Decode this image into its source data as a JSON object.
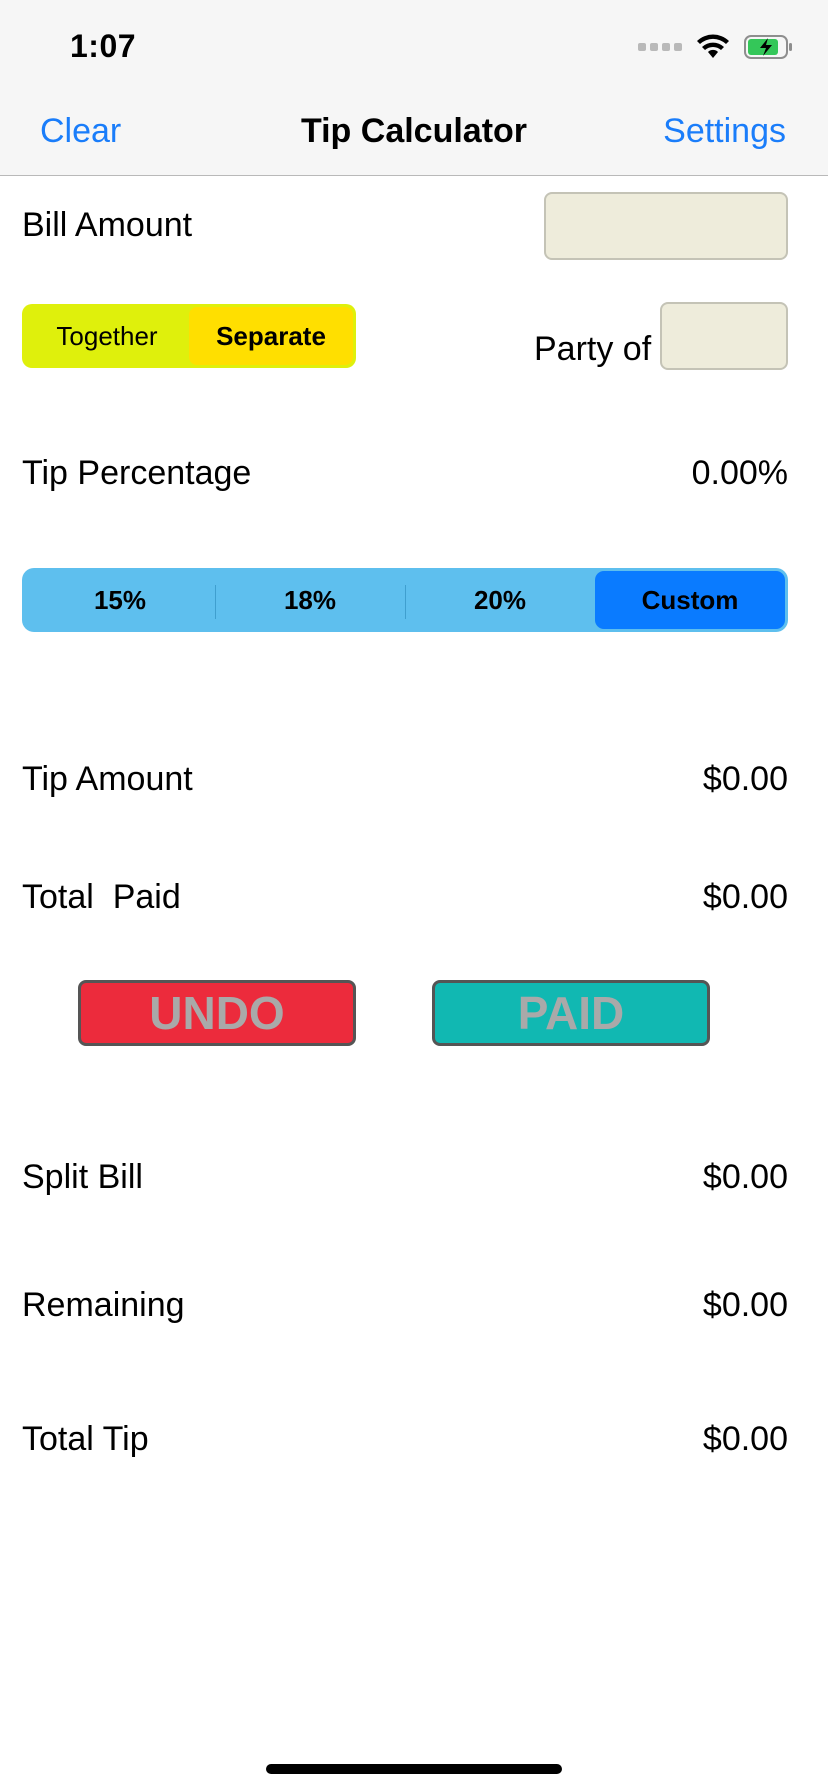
{
  "status_bar": {
    "time": "1:07"
  },
  "nav": {
    "left_button": "Clear",
    "title": "Tip Calculator",
    "right_button": "Settings"
  },
  "bill": {
    "label": "Bill Amount",
    "value": ""
  },
  "split_mode": {
    "options": [
      "Together",
      "Separate"
    ],
    "selected": "Separate"
  },
  "party": {
    "label": "Party of",
    "value": ""
  },
  "tip_percentage": {
    "label": "Tip Percentage",
    "value": "0.00%"
  },
  "tip_options": {
    "options": [
      "15%",
      "18%",
      "20%",
      "Custom"
    ],
    "selected": "Custom"
  },
  "tip_amount": {
    "label": "Tip Amount",
    "value": "$0.00"
  },
  "total_paid": {
    "label": "Total  Paid",
    "value": "$0.00"
  },
  "actions": {
    "undo": "UNDO",
    "paid": "PAID"
  },
  "split_bill": {
    "label": "Split Bill",
    "value": "$0.00"
  },
  "remaining": {
    "label": "Remaining",
    "value": "$0.00"
  },
  "total_tip": {
    "label": "Total Tip",
    "value": "$0.00"
  },
  "colors": {
    "accent_blue": "#1a7dfa",
    "segment_yellow_green": "#dff00c",
    "segment_selected_yellow": "#ffdf00",
    "segment_tip_bg": "#5ebfee",
    "segment_tip_selected": "#0a7bff",
    "undo_red": "#ec2b3c",
    "paid_teal": "#11b8b2",
    "field_bg": "#eeecdb"
  }
}
